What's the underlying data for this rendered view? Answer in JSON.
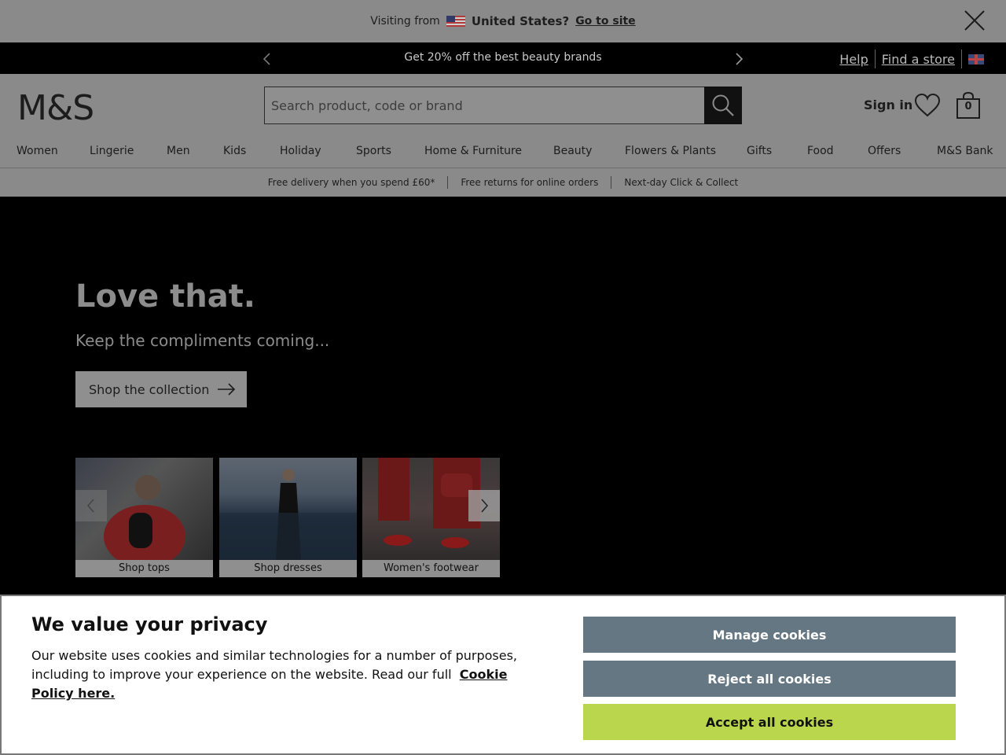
{
  "visit_bar": {
    "prefix": "Visiting from",
    "country": "United States?",
    "go_link": "Go to site"
  },
  "promo": {
    "text": "Get 20% off the best beauty brands",
    "help": "Help",
    "find_store": "Find a store"
  },
  "header": {
    "logo": "M&S",
    "search_placeholder": "Search product, code or brand",
    "sign_in": "Sign in",
    "bag_count": "0"
  },
  "nav": {
    "items": [
      "Women",
      "Lingerie",
      "Men",
      "Kids",
      "Holiday",
      "Sports",
      "Home & Furniture",
      "Beauty",
      "Flowers & Plants",
      "Gifts",
      "Food",
      "Offers",
      "M&S Bank"
    ]
  },
  "benefits": {
    "items": [
      "Free delivery when you spend £60*",
      "Free returns for online orders",
      "Next-day Click & Collect"
    ]
  },
  "hero": {
    "title": "Love that.",
    "subtitle": "Keep the compliments coming...",
    "cta": "Shop the collection",
    "tiles": [
      {
        "caption": "Shop tops"
      },
      {
        "caption": "Shop dresses"
      },
      {
        "caption": "Women's footwear"
      }
    ]
  },
  "cookie": {
    "title": "We value your privacy",
    "body": "Our website uses cookies and similar technologies for a number of purposes, including to improve your experience on the website. Read our full",
    "link": "Cookie Policy here.",
    "manage": "Manage cookies",
    "reject": "Reject all cookies",
    "accept": "Accept all cookies"
  },
  "colors": {
    "overlay_gray": "#8a8a8a",
    "button_slate": "#647782",
    "accept_green": "#bad64c"
  },
  "icons": {
    "close": "close-icon",
    "prev": "chevron-left-icon",
    "next": "chevron-right-icon",
    "search": "search-icon",
    "wishlist": "heart-icon",
    "bag": "bag-icon",
    "arrow": "arrow-right-icon"
  }
}
